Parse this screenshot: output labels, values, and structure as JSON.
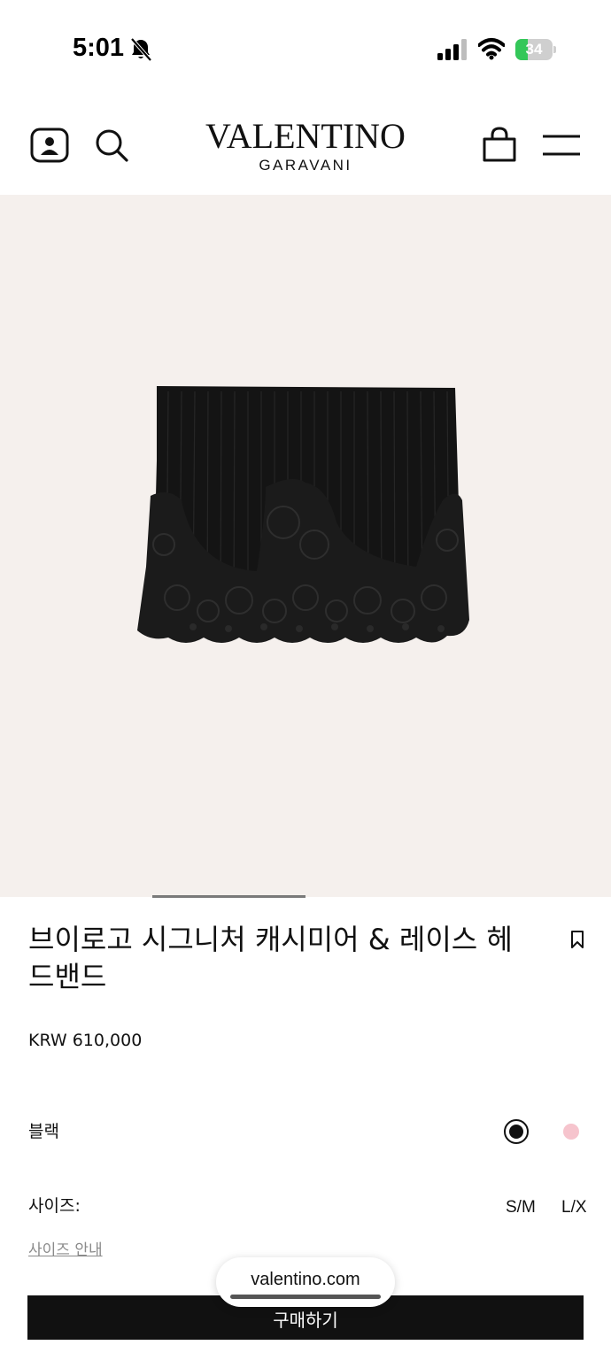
{
  "status_bar": {
    "time": "5:01",
    "battery": "34",
    "battery_level": 0.34,
    "icons": [
      "bell-off-icon",
      "signal-icon",
      "wifi-icon",
      "battery-icon"
    ]
  },
  "header": {
    "logo_main": "VALENTINO",
    "logo_sub": "GARAVANI",
    "icons": [
      "account-icon",
      "search-icon",
      "bag-icon",
      "menu-icon"
    ]
  },
  "product": {
    "title": "브이로고 시그니처 캐시미어 & 레이스 헤드밴드",
    "price": "KRW 610,000",
    "color_label": "블랙",
    "colors": [
      {
        "name": "black",
        "hex": "#111111",
        "selected": true
      },
      {
        "name": "pink",
        "hex": "#f6c4cd",
        "selected": false
      }
    ],
    "size_label": "사이즈:",
    "sizes": [
      "S/M",
      "L/X"
    ],
    "size_guide": "사이즈 안내",
    "buy_label": "구매하기"
  },
  "browser": {
    "url": "valentino.com"
  },
  "colors": {
    "image_bg": "#f5f0ed",
    "primary": "#111111"
  }
}
